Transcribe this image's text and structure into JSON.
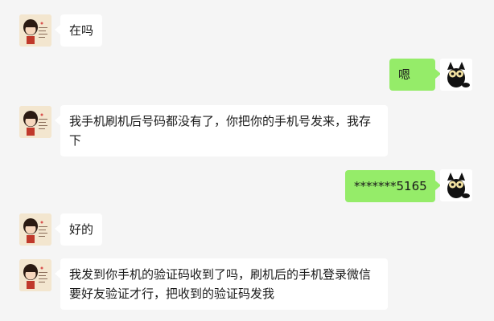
{
  "chat": {
    "messages": [
      {
        "side": "in",
        "text": "在吗"
      },
      {
        "side": "out",
        "text": "嗯"
      },
      {
        "side": "in",
        "text": "我手机刷机后号码都没有了，你把你的手机号发来，我存下"
      },
      {
        "side": "out",
        "text": "*******5165"
      },
      {
        "side": "in",
        "text": "好的"
      },
      {
        "side": "in",
        "text": "我发到你手机的验证码收到了吗，刷机后的手机登录微信要好友验证才行，把收到的验证码发我"
      }
    ]
  },
  "colors": {
    "background": "#f5f5f5",
    "incoming_bubble": "#ffffff",
    "outgoing_bubble": "#95ec69"
  },
  "icons": {
    "contact_avatar": "cartoon-girl-avatar-icon",
    "self_avatar": "black-cat-avatar-icon"
  }
}
